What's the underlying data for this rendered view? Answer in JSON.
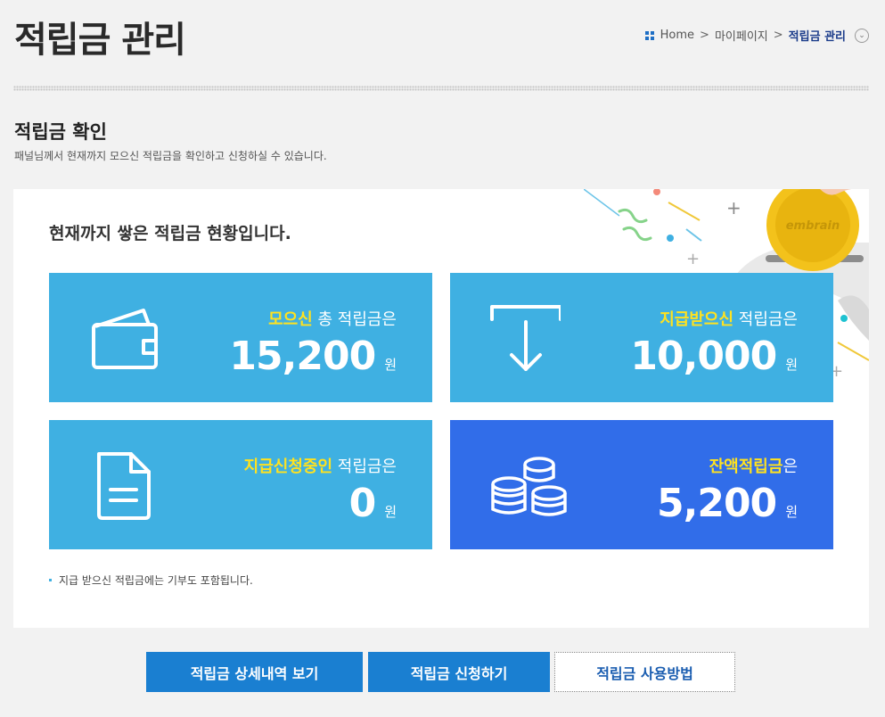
{
  "page": {
    "title": "적립금 관리"
  },
  "breadcrumb": {
    "home": "Home",
    "sep": ">",
    "mypage": "마이페이지",
    "current": "적립금 관리"
  },
  "section": {
    "title": "적립금 확인",
    "desc": "패널님께서 현재까지 모으신 적립금을 확인하고 신청하실 수 있습니다."
  },
  "panel": {
    "heading": "현재까지 쌓은 적립금 현황입니다.",
    "coin_brand": "embrain",
    "cards": [
      {
        "highlight": "모으신",
        "rest": " 총 적립금은",
        "amount": "15,200",
        "unit": "원",
        "icon": "wallet-icon"
      },
      {
        "highlight": "지급받으신",
        "rest": " 적립금은",
        "amount": "10,000",
        "unit": "원",
        "icon": "download-tray-icon"
      },
      {
        "highlight": "지급신청중인",
        "rest": " 적립금은",
        "amount": "0",
        "unit": "원",
        "icon": "document-icon"
      },
      {
        "highlight": "잔액적립금",
        "rest": "은",
        "amount": "5,200",
        "unit": "원",
        "icon": "coin-stack-icon"
      }
    ],
    "note": "지급 받으신 적립금에는 기부도 포함됩니다."
  },
  "buttons": {
    "history": "적립금 상세내역 보기",
    "apply": "적립금 신청하기",
    "howto": "적립금 사용방법"
  },
  "colors": {
    "card_light": "#3fb0e2",
    "card_dark": "#316de9",
    "highlight": "#ffe21f",
    "button": "#1a7fd1"
  }
}
